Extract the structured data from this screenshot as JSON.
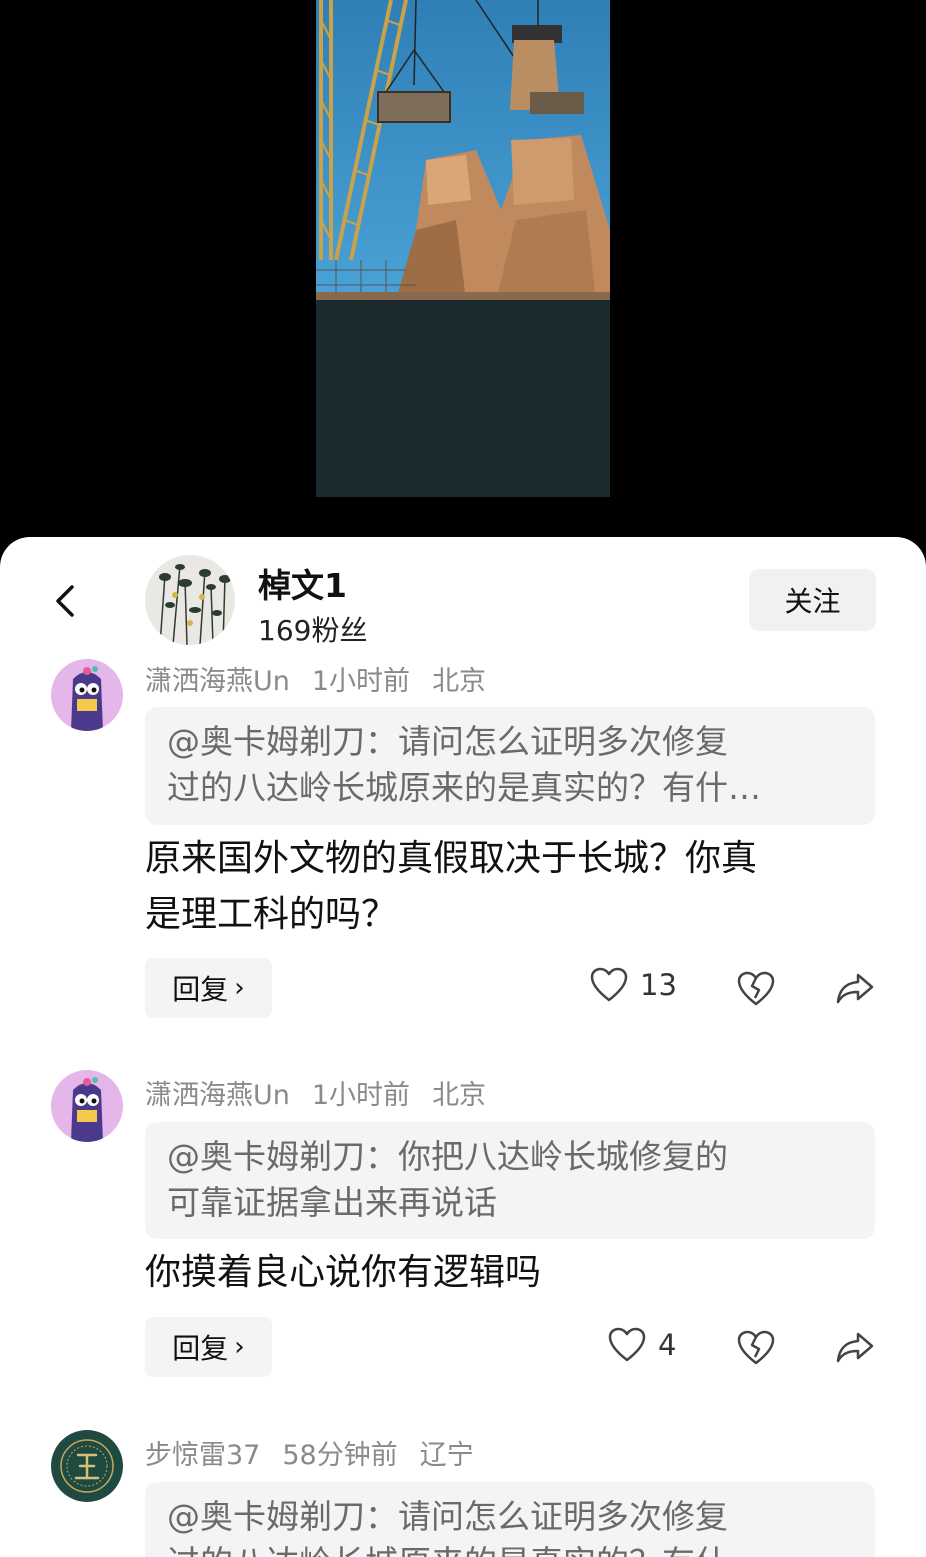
{
  "author": {
    "name": "棹文1",
    "fans": "169粉丝",
    "follow_label": "关注"
  },
  "comments": [
    {
      "user": "潇洒海燕Un",
      "time": "1小时前",
      "location": "北京",
      "quote_line1": "@奥卡姆剃刀：请问怎么证明多次修复",
      "quote_line2": "过的八达岭长城原来的是真实的？有什…",
      "text_line1": "原来国外文物的真假取决于长城？你真",
      "text_line2": "是理工科的吗？",
      "reply_label": "回复",
      "likes": "13"
    },
    {
      "user": "潇洒海燕Un",
      "time": "1小时前",
      "location": "北京",
      "quote_line1": "@奥卡姆剃刀：你把八达岭长城修复的",
      "quote_line2": "可靠证据拿出来再说话",
      "text_line1": "你摸着良心说你有逻辑吗",
      "reply_label": "回复",
      "likes": "4"
    },
    {
      "user": "步惊雷37",
      "time": "58分钟前",
      "location": "辽宁",
      "quote_line1": "@奥卡姆剃刀：请问怎么证明多次修复",
      "quote_line2": "过的八达岭长城原来的是真实的？有什"
    }
  ],
  "colors": {
    "background": "#000000",
    "sheet": "#ffffff",
    "muted_text": "#8a8a8a",
    "quote_bg": "#f3f4f5"
  },
  "icons": [
    "back-icon",
    "heart-icon",
    "broken-heart-icon",
    "share-icon"
  ]
}
